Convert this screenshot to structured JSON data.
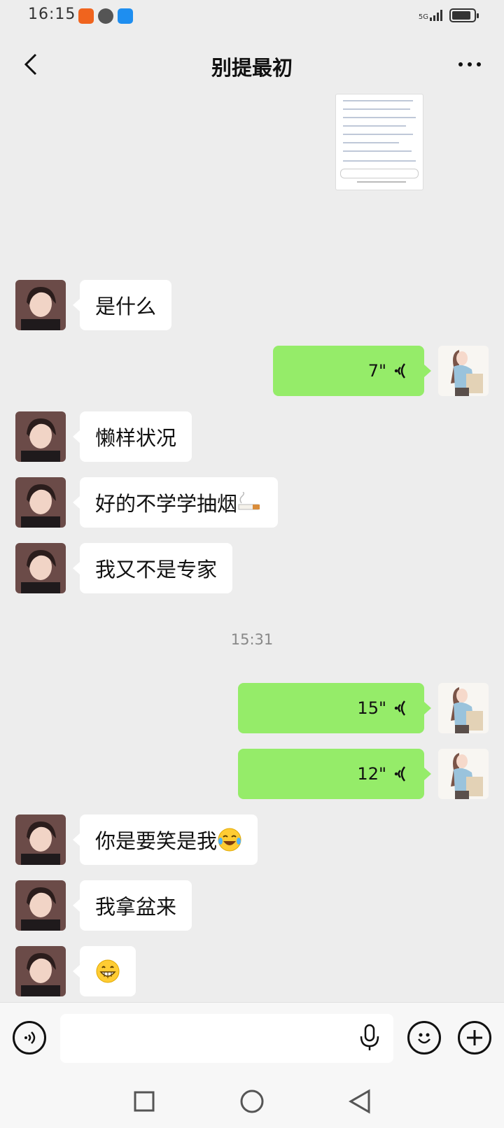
{
  "status_bar": {
    "time": "16:15",
    "network": "5G"
  },
  "header": {
    "title": "别提最初"
  },
  "messages": [
    {
      "side": "in",
      "type": "text",
      "text": "是什么"
    },
    {
      "side": "out",
      "type": "voice",
      "duration": "7\""
    },
    {
      "side": "in",
      "type": "text",
      "text": "懒样状况"
    },
    {
      "side": "in",
      "type": "text",
      "text": "好的不学学抽烟",
      "emoji": "cigarette"
    },
    {
      "side": "in",
      "type": "text",
      "text": "我又不是专家"
    },
    {
      "side": "out",
      "type": "voice",
      "duration": "15\""
    },
    {
      "side": "out",
      "type": "voice",
      "duration": "12\""
    },
    {
      "side": "in",
      "type": "text",
      "text": "你是要笑是我",
      "emoji": "laughing-crying"
    },
    {
      "side": "in",
      "type": "text",
      "text": "我拿盆来"
    },
    {
      "side": "in",
      "type": "emoji",
      "emoji": "grinning"
    }
  ],
  "timestamp": "15:31",
  "icons": {
    "back": "chevron-left-icon",
    "more": "more-dots-icon",
    "voice_toggle": "voice-mode-icon",
    "mic": "mic-icon",
    "emoji": "smiley-icon",
    "plus": "plus-icon"
  },
  "colors": {
    "outgoing_bubble": "#95ec69",
    "incoming_bubble": "#ffffff",
    "background": "#ededed"
  }
}
